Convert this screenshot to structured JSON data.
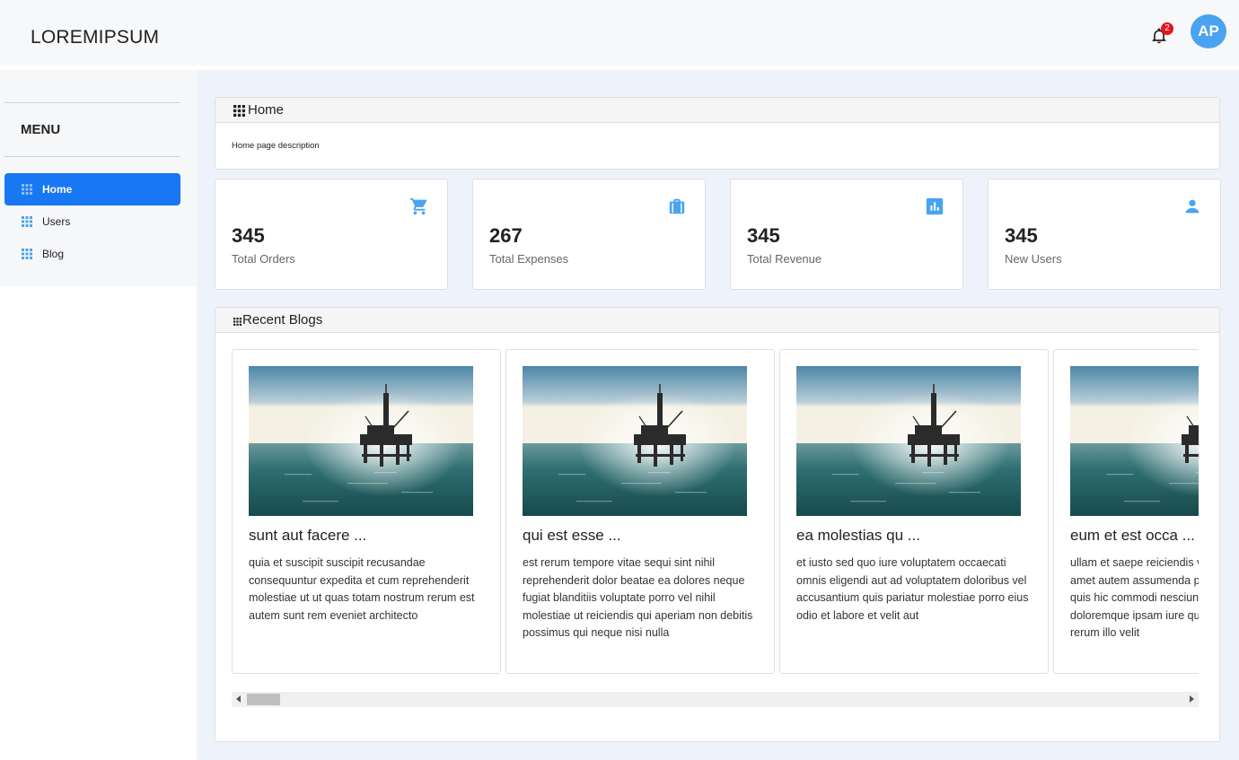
{
  "app": {
    "brand": "LOREMIPSUM"
  },
  "header": {
    "notification_count": "2",
    "avatar_initials": "AP"
  },
  "sidebar": {
    "menu_title": "MENU",
    "items": [
      {
        "label": "Home",
        "active": true
      },
      {
        "label": "Users",
        "active": false
      },
      {
        "label": "Blog",
        "active": false
      }
    ]
  },
  "home_panel": {
    "title": "Home",
    "description": "Home page description"
  },
  "stats": [
    {
      "value": "345",
      "label": "Total Orders",
      "icon": "cart-icon"
    },
    {
      "value": "267",
      "label": "Total Expenses",
      "icon": "briefcase-icon"
    },
    {
      "value": "345",
      "label": "Total Revenue",
      "icon": "bar-chart-icon"
    },
    {
      "value": "345",
      "label": "New Users",
      "icon": "user-icon"
    }
  ],
  "blogs_panel": {
    "title": "Recent Blogs",
    "posts": [
      {
        "title": "sunt aut facere ...",
        "body": "quia et suscipit suscipit recusandae consequuntur expedita et cum reprehenderit molestiae ut ut quas totam nostrum rerum est autem sunt rem eveniet architecto"
      },
      {
        "title": "qui est esse ...",
        "body": "est rerum tempore vitae sequi sint nihil reprehenderit dolor beatae ea dolores neque fugiat blanditiis voluptate porro vel nihil molestiae ut reiciendis qui aperiam non debitis possimus qui neque nisi nulla"
      },
      {
        "title": "ea molestias qu ...",
        "body": "et iusto sed quo iure voluptatem occaecati omnis eligendi aut ad voluptatem doloribus vel accusantium quis pariatur molestiae porro eius odio et labore et velit aut"
      },
      {
        "title": "eum et est occa ...",
        "body": "ullam et saepe reiciendis voluptatem adipisci sit amet autem assumenda provident rerum culpa quis hic commodi nesciunt rem tenetur doloremque ipsam iure quis sunt voluptatem rerum illo velit"
      }
    ]
  },
  "colors": {
    "accent": "#1877f2",
    "icon_blue": "#4aa3f0",
    "badge_red": "#e3141b",
    "main_bg": "#eef3fb"
  }
}
